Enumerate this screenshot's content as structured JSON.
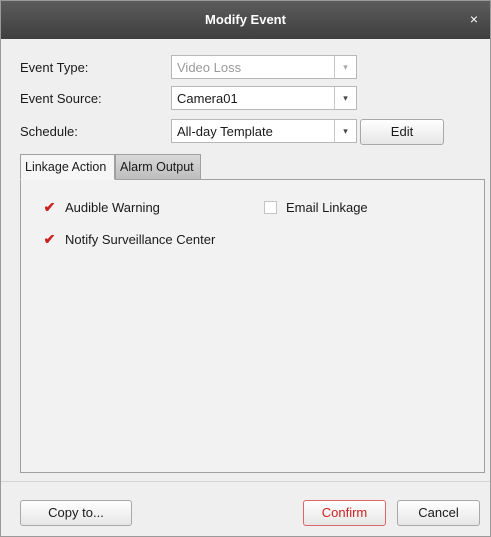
{
  "dialog": {
    "title": "Modify Event",
    "close_glyph": "×"
  },
  "form": {
    "event_type": {
      "label": "Event Type:",
      "value": "Video Loss",
      "disabled": true
    },
    "event_source": {
      "label": "Event Source:",
      "value": "Camera01"
    },
    "schedule": {
      "label": "Schedule:",
      "value": "All-day Template",
      "edit_label": "Edit"
    }
  },
  "tabs": [
    {
      "label": "Linkage Action",
      "active": true
    },
    {
      "label": "Alarm Output",
      "active": false
    }
  ],
  "linkage": {
    "audible_warning": {
      "label": "Audible Warning",
      "checked": true
    },
    "email_linkage": {
      "label": "Email Linkage",
      "checked": false
    },
    "notify_center": {
      "label": "Notify Surveillance Center",
      "checked": true
    }
  },
  "footer": {
    "copy_to_label": "Copy to...",
    "confirm_label": "Confirm",
    "cancel_label": "Cancel"
  },
  "icons": {
    "dropdown": "chevron-down-icon",
    "check": "checkmark-icon",
    "close": "close-icon"
  },
  "colors": {
    "titlebar": "#4a4a4a",
    "check_mark": "#cc2020",
    "confirm_text": "#cc2222"
  }
}
